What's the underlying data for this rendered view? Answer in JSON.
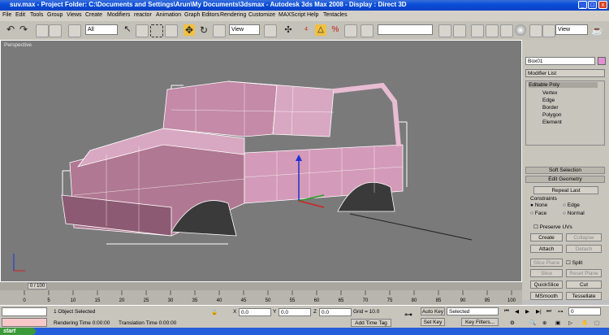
{
  "window": {
    "title": "suv.max     - Project Folder: C:\\Documents and Settings\\Arun\\My Documents\\3dsmax     - Autodesk 3ds Max 2008     - Display : Direct 3D"
  },
  "menu": [
    "File",
    "Edit",
    "Tools",
    "Group",
    "Views",
    "Create",
    "Modifiers",
    "reactor",
    "Animation",
    "Graph Editors",
    "Rendering",
    "Customize",
    "MAXScript",
    "Help",
    "Tentacles"
  ],
  "toolbar": {
    "selection_filter": "All",
    "ref_coord": "View",
    "named_selection": "",
    "render_view": "View"
  },
  "viewport": {
    "label": "Perspective"
  },
  "command_panel": {
    "object_name": "Box01",
    "modifier_list": "Modifier List",
    "stack": [
      "Editable Poly",
      "Vertex",
      "Edge",
      "Border",
      "Polygon",
      "Element"
    ],
    "soft_selection": "Soft Selection",
    "edit_geometry": "Edit Geometry",
    "repeat_last": "Repeat Last",
    "constraints_label": "Constraints",
    "constraints": [
      "None",
      "Edge",
      "Face",
      "Normal"
    ],
    "preserve_uvs": "Preserve UVs",
    "create": "Create",
    "collapse": "Collapse",
    "attach": "Attach",
    "detach": "Detach",
    "slice_plane": "Slice Plane",
    "split": "Split",
    "slice": "Slice",
    "reset_plane": "Reset Plane",
    "quickslice": "QuickSlice",
    "cut": "Cut",
    "msmooth": "MSmooth",
    "tessellate": "Tessellate"
  },
  "timeline": {
    "slider_label": "0 / 100",
    "ticks": [
      "0",
      "5",
      "10",
      "15",
      "20",
      "25",
      "30",
      "35",
      "40",
      "45",
      "50",
      "55",
      "60",
      "65",
      "70",
      "75",
      "80",
      "85",
      "90",
      "95",
      "100"
    ]
  },
  "status": {
    "selected": "1 Object Selected",
    "rendering_time": "Rendering Time  0:00:00",
    "translation_time": "Translation Time  0:00:00",
    "x_label": "X",
    "x_value": "0.0",
    "y_label": "Y",
    "y_value": "0.0",
    "z_label": "Z",
    "z_value": "0.0",
    "grid": "Grid = 10.0",
    "add_time_tag": "Add Time Tag",
    "auto_key": "Auto Key",
    "set_key": "Set Key",
    "selected_dropdown": "Selected",
    "key_filters": "Key Filters...",
    "frame": "0"
  },
  "taskbar": {
    "start": "start"
  },
  "colors": {
    "model": "#d49ab9",
    "viewport_bg": "#7a7a7a",
    "title_blue": "#0a4fd8"
  }
}
